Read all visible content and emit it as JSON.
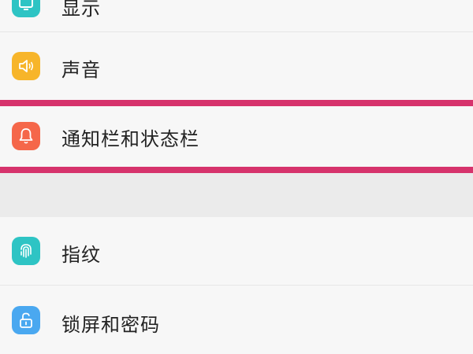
{
  "settings": {
    "items": [
      {
        "label": "显示",
        "icon": "display-icon",
        "color": "#2ec4c4"
      },
      {
        "label": "声音",
        "icon": "speaker-icon",
        "color": "#f7b52a"
      },
      {
        "label": "通知栏和状态栏",
        "icon": "bell-icon",
        "color": "#f5674a"
      },
      {
        "label": "指纹",
        "icon": "fingerprint-icon",
        "color": "#2ec4c4"
      },
      {
        "label": "锁屏和密码",
        "icon": "lock-icon",
        "color": "#4aa8f0"
      }
    ]
  },
  "highlight": {
    "color": "#d6336c"
  }
}
